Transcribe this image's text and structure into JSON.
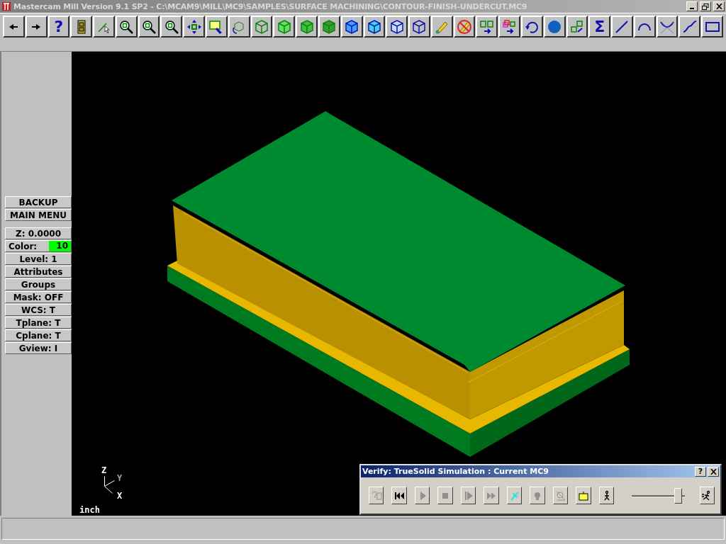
{
  "window": {
    "title": "Mastercam Mill Version 9.1 SP2 - C:\\MCAM9\\MILL\\MC9\\SAMPLES\\SURFACE MACHINING\\CONTOUR-FINISH-UNDERCUT.MC9"
  },
  "toolbar": {
    "help_glyph": "?",
    "sum_glyph": "Σ"
  },
  "menu": {
    "commands": [
      "BACKUP",
      "MAIN MENU"
    ],
    "settings": [
      {
        "label": "Z:  0.0000"
      },
      {
        "label": "Color:",
        "value": "10",
        "color": "#00ff00"
      },
      {
        "label": "Level:  1"
      },
      {
        "label": "Attributes"
      },
      {
        "label": "Groups"
      },
      {
        "label": "Mask:  OFF"
      },
      {
        "label": "WCS:   T"
      },
      {
        "label": "Tplane:  T"
      },
      {
        "label": "Cplane:  T"
      },
      {
        "label": "Gview:   I"
      }
    ]
  },
  "viewport": {
    "axes": {
      "z": "Z",
      "y": "Y",
      "x": "X"
    },
    "units": "inch"
  },
  "verify_dialog": {
    "title": "Verify: TrueSolid Simulation : Current MC9",
    "help": "?",
    "buttons": [
      {
        "disabled": true
      },
      {
        "disabled": false
      },
      {
        "disabled": true
      },
      {
        "disabled": true
      },
      {
        "disabled": true
      },
      {
        "disabled": true
      },
      {
        "disabled": false
      },
      {
        "disabled": true
      },
      {
        "disabled": true
      },
      {
        "disabled": false
      },
      {
        "disabled": false
      }
    ],
    "speed": {
      "level": 0.95
    },
    "end_button": {
      "disabled": false
    }
  }
}
